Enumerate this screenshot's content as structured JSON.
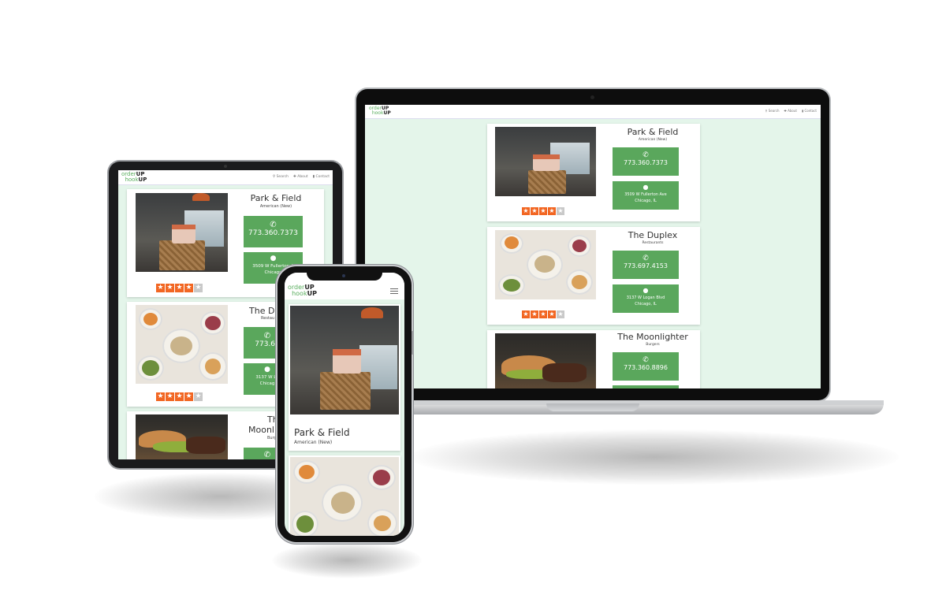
{
  "app": {
    "logo_line1_light": "order",
    "logo_line1_bold": "UP",
    "logo_line2_light": "hook",
    "logo_line2_bold": "UP"
  },
  "nav": {
    "search_label": "Search",
    "about_label": "About",
    "contact_label": "Contact",
    "menu_icon": "hamburger-menu-icon"
  },
  "restaurants": [
    {
      "name": "Park & Field",
      "category": "American (New)",
      "phone": "773.360.7373",
      "address_line1": "3509 W Fullerton Ave",
      "address_line2": "Chicago, IL",
      "rating": 4,
      "rating_max": 5
    },
    {
      "name": "The Duplex",
      "category": "Restaurants",
      "phone": "773.697.4153",
      "address_line1": "3137 W Logan Blvd",
      "address_line2": "Chicago, IL",
      "rating": 4,
      "rating_max": 5
    },
    {
      "name": "The Moonlighter",
      "category": "Burgers",
      "phone": "773.360.8896"
    }
  ],
  "tablet_truncated": {
    "duplex_name": "The Du",
    "duplex_category": "Restau",
    "duplex_phone": "773.69",
    "duplex_address1": "3137 W Lo",
    "duplex_address2": "Chicag",
    "moon_name1": "The",
    "moon_name2": "Moonli",
    "moon_category": "Burg",
    "park_address1": "3509 W Fullerton A",
    "park_address2": "Chicago"
  },
  "colors": {
    "accent_green": "#5aa75c",
    "background_mint": "#e4f5ea",
    "star_orange": "#f26622",
    "star_off": "#c9c9c9"
  }
}
